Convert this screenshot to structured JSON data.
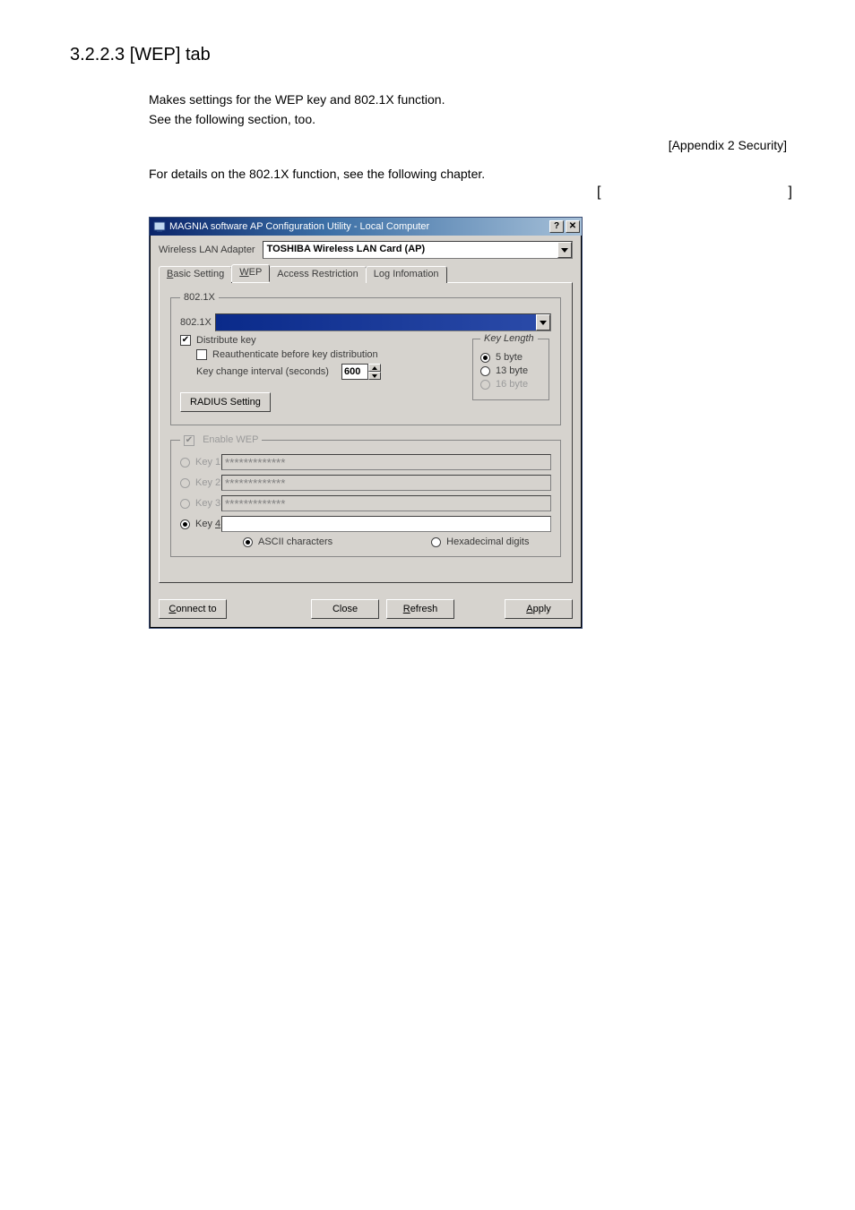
{
  "doc": {
    "heading": "3.2.2.3 [WEP] tab",
    "para1_line1": "Makes settings for the WEP key and 802.1X function.",
    "para1_line2": "See the following section, too.",
    "appendix_link": "[Appendix 2  Security]",
    "para2": "For details on the 802.1X function, see the following chapter.",
    "bracket_left": "[",
    "bracket_right": "]"
  },
  "dialog": {
    "title": "MAGNIA software AP Configuration Utility - Local Computer",
    "help_glyph": "?",
    "close_glyph": "✕",
    "adapter_label": "Wireless LAN Adapter",
    "adapter_value": "TOSHIBA Wireless LAN Card (AP)",
    "tabs": {
      "basic": "Basic Setting",
      "wep": "WEP",
      "access": "Access Restriction",
      "log": "Log Infomation"
    },
    "group_8021x": {
      "legend": "802.1X",
      "mode_label": "802.1X",
      "mode_value": "",
      "distribute_key": "Distribute key",
      "reauth": "Reauthenticate before key distribution",
      "interval_label": "Key change interval (seconds)",
      "interval_value": "600",
      "radius_button": "RADIUS Setting",
      "keylen": {
        "legend": "Key Length",
        "b5": "5 byte",
        "b13": "13 byte",
        "b16": "16 byte"
      }
    },
    "group_wep": {
      "enable": "Enable WEP",
      "key1": "Key 1",
      "key2": "Key 2",
      "key3": "Key 3",
      "key4": "Key 4",
      "key1_value": "*************",
      "key2_value": "*************",
      "key3_value": "*************",
      "key4_value": "",
      "ascii": "ASCII characters",
      "hex": "Hexadecimal digits"
    },
    "footer": {
      "connect": "Connect to",
      "close": "Close",
      "refresh": "Refresh",
      "apply": "Apply"
    }
  }
}
